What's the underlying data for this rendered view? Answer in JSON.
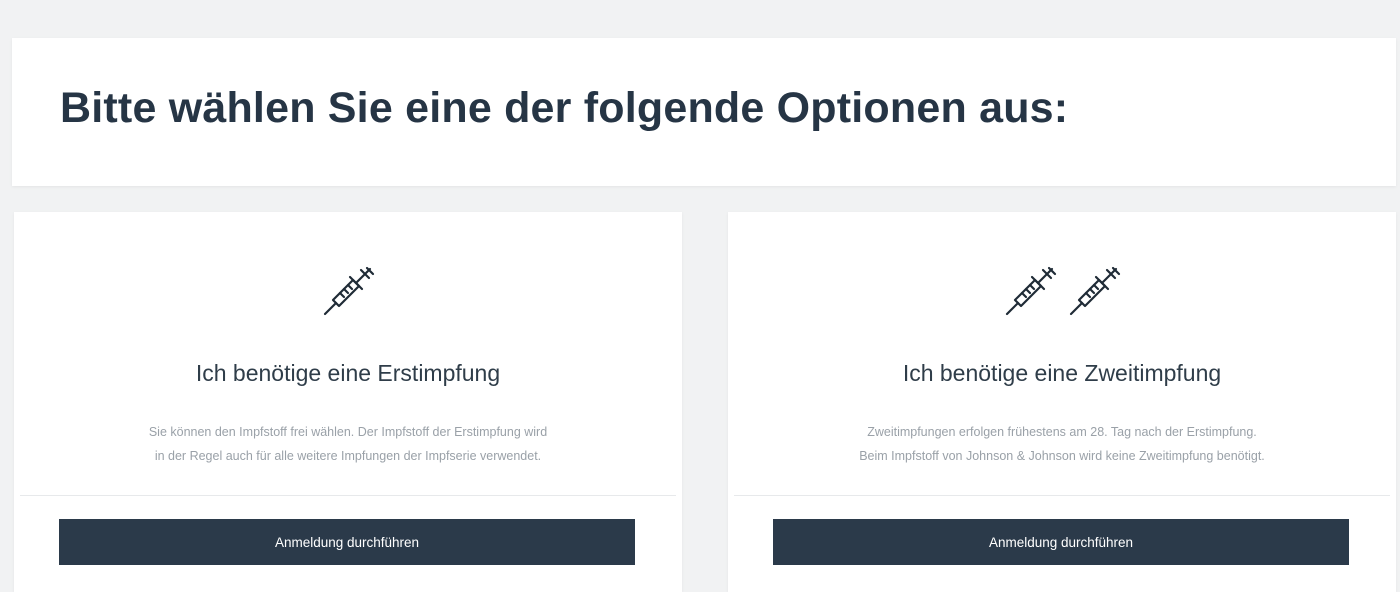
{
  "header": {
    "title": "Bitte wählen Sie eine der folgende Optionen aus:"
  },
  "options": [
    {
      "title": "Ich benötige eine Erstimpfung",
      "description_line1": "Sie können den Impfstoff frei wählen. Der Impfstoff der Erstimpfung wird",
      "description_line2": "in der Regel auch für alle weitere Impfungen der Impfserie verwendet.",
      "button_label": "Anmeldung durchführen",
      "icon": "syringe-icon"
    },
    {
      "title": "Ich benötige eine Zweitimpfung",
      "description_line1": "Zweitimpfungen erfolgen frühestens am 28. Tag nach der Erstimpfung.",
      "description_line2": "Beim Impfstoff von Johnson & Johnson wird keine Zweitimpfung benötigt.",
      "button_label": "Anmeldung durchführen",
      "icon": "two-syringes-icon"
    }
  ],
  "colors": {
    "background": "#f1f2f3",
    "card": "#ffffff",
    "title_text": "#263545",
    "description_text": "#9aa1a8",
    "button": "#2b3a4a",
    "button_text": "#ffffff"
  }
}
